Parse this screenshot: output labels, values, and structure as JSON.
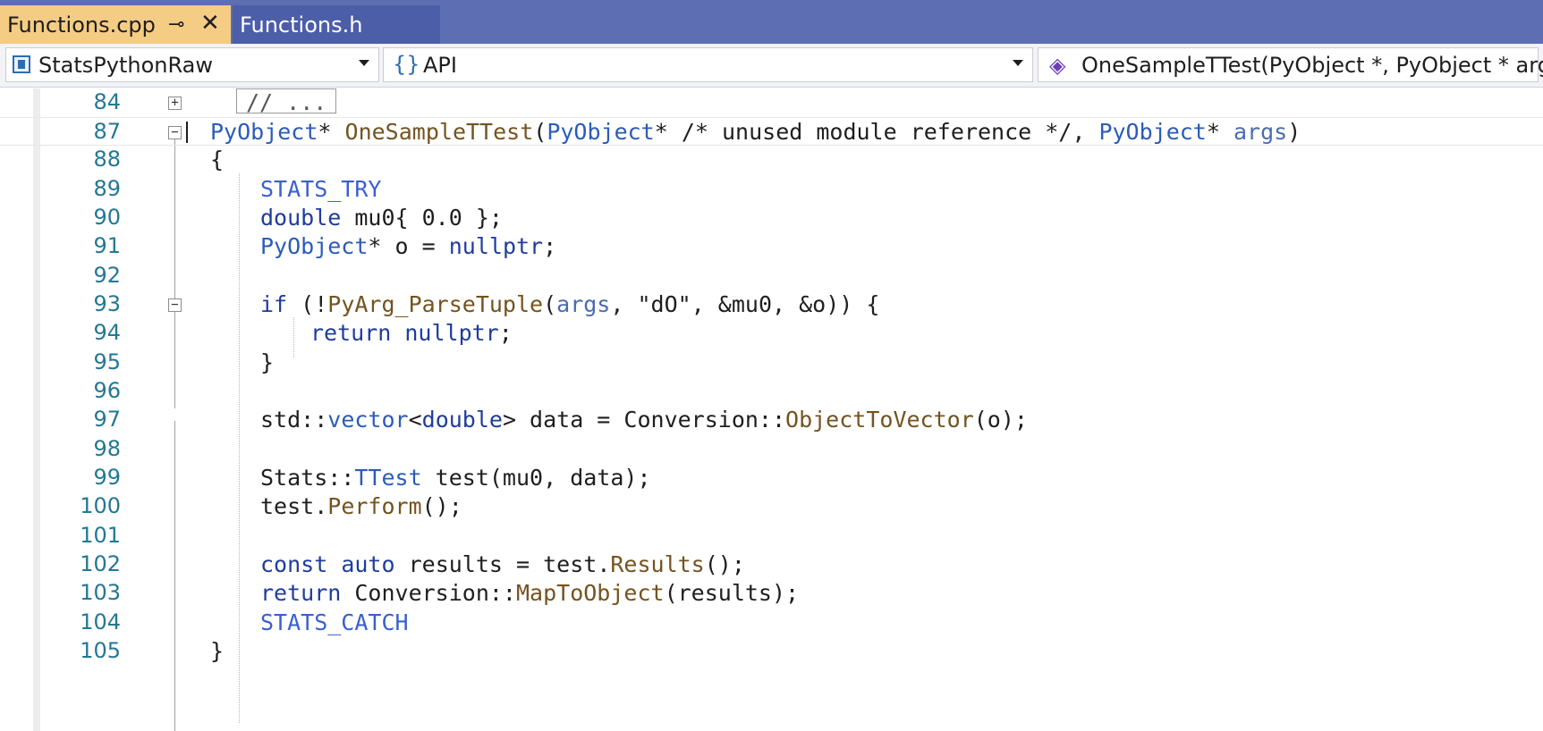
{
  "tabs": {
    "active": {
      "label": "Functions.cpp",
      "pin": "⊸",
      "close": "✕"
    },
    "inactive": {
      "label": "Functions.h"
    }
  },
  "nav": {
    "project": "StatsPythonRaw",
    "scope": "API",
    "member": "OneSampleTTest(PyObject *, PyObject * args)"
  },
  "editor": {
    "lines": [
      {
        "num": "84",
        "fold": "+",
        "collapsed": "// ..."
      },
      {
        "num": "87",
        "fold": "−",
        "code": ""
      },
      {
        "num": "88",
        "code": "{"
      },
      {
        "num": "89",
        "code": "STATS_TRY"
      },
      {
        "num": "90",
        "code": "double mu0{ 0.0 };"
      },
      {
        "num": "91",
        "code": "PyObject* o = nullptr;"
      },
      {
        "num": "92",
        "code": ""
      },
      {
        "num": "93",
        "fold": "−",
        "code": ""
      },
      {
        "num": "94",
        "code": ""
      },
      {
        "num": "95",
        "code": "}"
      },
      {
        "num": "96",
        "code": ""
      },
      {
        "num": "97",
        "code": ""
      },
      {
        "num": "98",
        "code": ""
      },
      {
        "num": "99",
        "code": ""
      },
      {
        "num": "100",
        "code": ""
      },
      {
        "num": "101",
        "code": ""
      },
      {
        "num": "102",
        "code": ""
      },
      {
        "num": "103",
        "code": ""
      },
      {
        "num": "104",
        "code": "STATS_CATCH"
      },
      {
        "num": "105",
        "code": "}"
      }
    ],
    "tokens": {
      "l87": [
        "PyObject",
        "* ",
        "OneSampleTTest",
        "(",
        "PyObject",
        "* /* unused module reference */, ",
        "PyObject",
        "* ",
        "args",
        ")"
      ],
      "l90": [
        "double",
        " mu0{ 0.0 };"
      ],
      "l91": [
        "PyObject",
        "* o = ",
        "nullptr",
        ";"
      ],
      "l93": [
        "if",
        " (!",
        "PyArg_ParseTuple",
        "(",
        "args",
        ", \"dO\", &mu0, &o)) {"
      ],
      "l94": [
        "return",
        " ",
        "nullptr",
        ";"
      ],
      "l97": [
        "std::",
        "vector",
        "<",
        "double",
        "> data = Conversion::",
        "ObjectToVector",
        "(o);"
      ],
      "l99": [
        "Stats::",
        "TTest",
        " test(mu0, data);"
      ],
      "l100": [
        "test.",
        "Perform",
        "();"
      ],
      "l102": [
        "const",
        " ",
        "auto",
        " results = test.",
        "Results",
        "();"
      ],
      "l103": [
        "return",
        " Conversion::",
        "MapToObject",
        "(results);"
      ]
    }
  }
}
